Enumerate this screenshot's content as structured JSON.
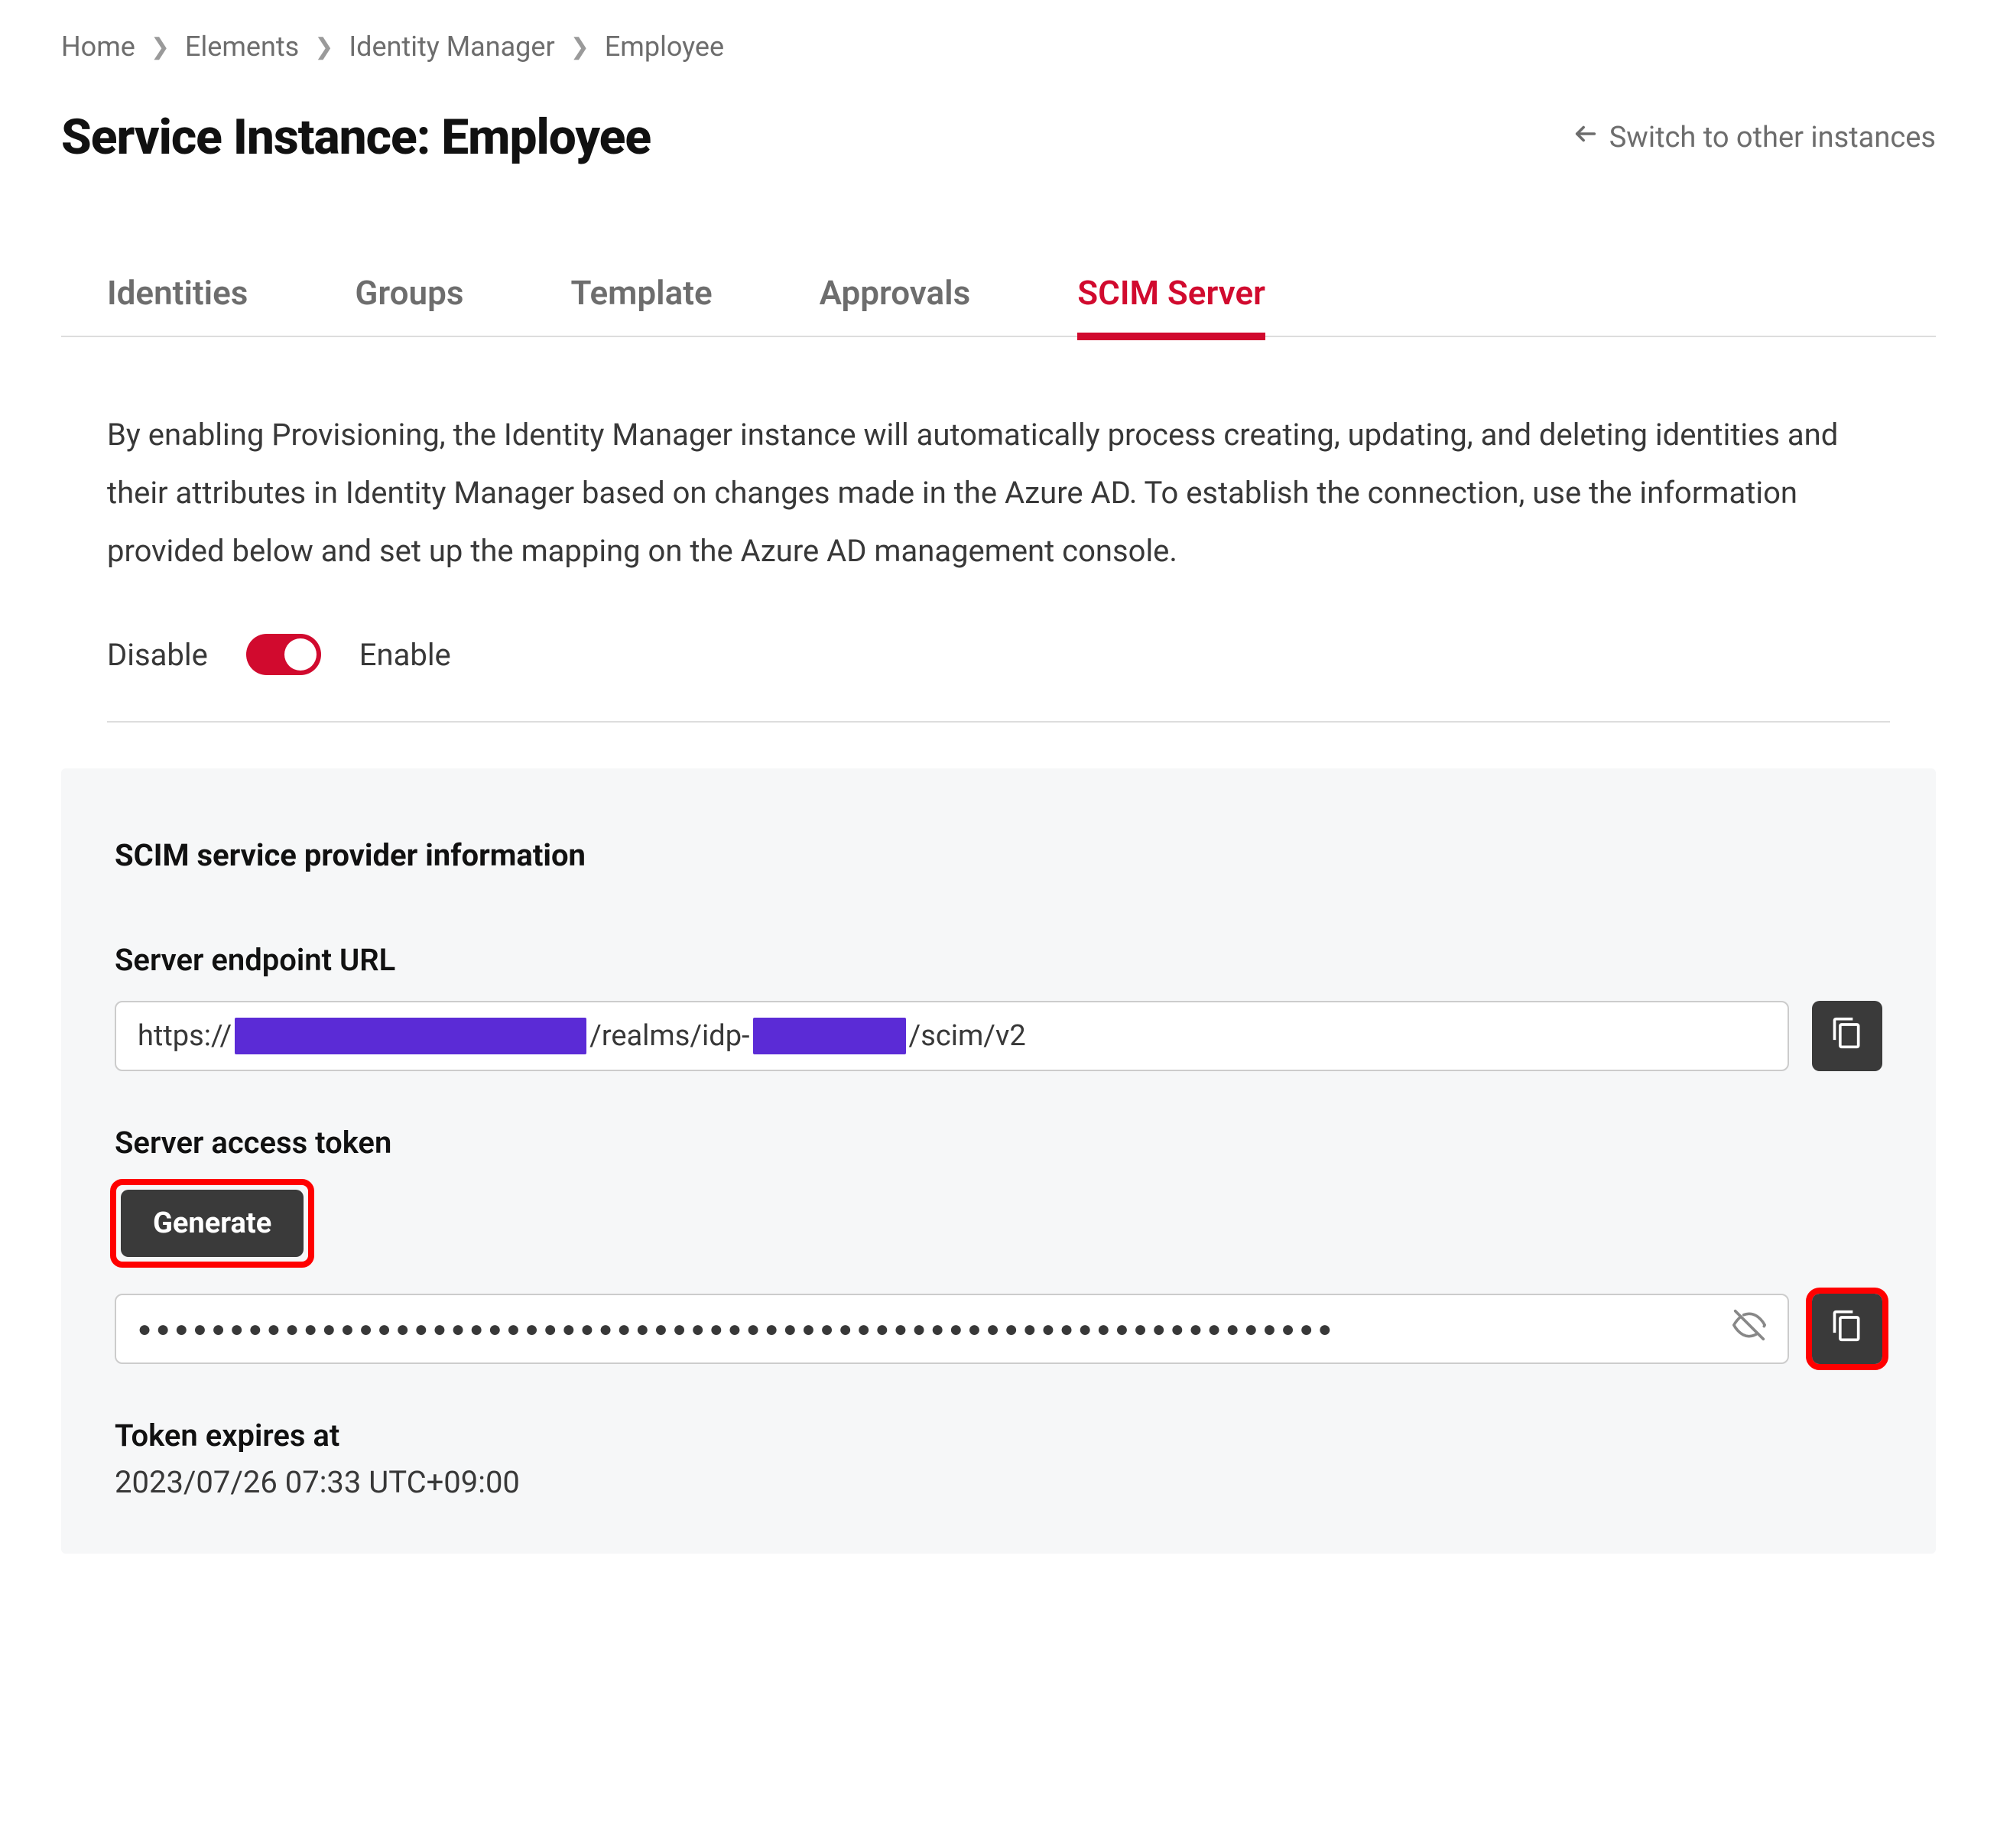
{
  "breadcrumb": {
    "items": [
      "Home",
      "Elements",
      "Identity Manager",
      "Employee"
    ]
  },
  "header": {
    "title": "Service Instance: Employee",
    "switch_label": "Switch to other instances"
  },
  "tabs": [
    {
      "label": "Identities"
    },
    {
      "label": "Groups"
    },
    {
      "label": "Template"
    },
    {
      "label": "Approvals"
    },
    {
      "label": "SCIM Server",
      "active": true
    }
  ],
  "scim": {
    "description": "By enabling Provisioning, the Identity Manager instance will automatically process creating, updating, and deleting identities and their attributes in Identity Manager based on changes made in the Azure AD. To establish the connection, use the information provided below and set up the mapping on the Azure AD management console.",
    "toggle": {
      "off_label": "Disable",
      "on_label": "Enable",
      "enabled": true
    },
    "card_title": "SCIM service provider information",
    "endpoint": {
      "label": "Server endpoint URL",
      "prefix": "https://",
      "mid1": "/realms/idp-",
      "suffix": "/scim/v2"
    },
    "token": {
      "label": "Server access token",
      "generate_label": "Generate",
      "masked_value": "●●●●●●●●●●●●●●●●●●●●●●●●●●●●●●●●●●●●●●●●●●●●●●●●●●●●●●●●●●●●●●●●●"
    },
    "expires": {
      "label": "Token expires at",
      "value": "2023/07/26 07:33 UTC+09:00"
    }
  }
}
